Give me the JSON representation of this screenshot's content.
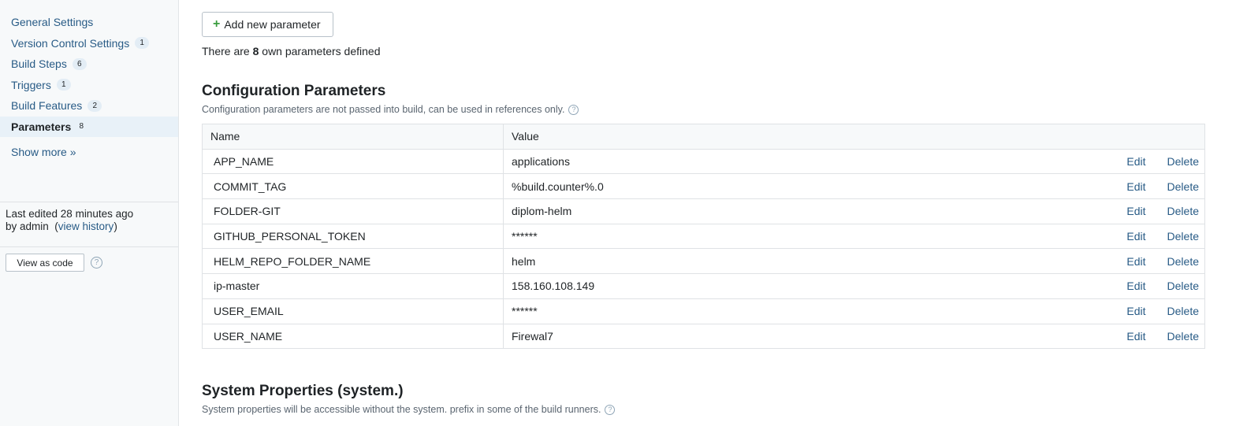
{
  "sidebar": {
    "items": [
      {
        "label": "General Settings",
        "badge": ""
      },
      {
        "label": "Version Control Settings",
        "badge": "1"
      },
      {
        "label": "Build Steps",
        "badge": "6"
      },
      {
        "label": "Triggers",
        "badge": "1"
      },
      {
        "label": "Build Features",
        "badge": "2"
      },
      {
        "label": "Parameters",
        "badge": "8",
        "active": true
      }
    ],
    "show_more": "Show more »",
    "last_edited_line1": "Last edited 28 minutes ago",
    "last_edited_by": "by admin",
    "view_history": "view history",
    "view_as_code": "View as code",
    "help_glyph": "?"
  },
  "main": {
    "add_button_label": "Add new parameter",
    "plus_glyph": "+",
    "own_params_prefix": "There are ",
    "own_params_count": "8",
    "own_params_suffix": " own parameters defined",
    "config_section": {
      "title": "Configuration Parameters",
      "description": "Configuration parameters are not passed into build, can be used in references only."
    },
    "table": {
      "headers": {
        "name": "Name",
        "value": "Value"
      },
      "rows": [
        {
          "name": "APP_NAME",
          "value": "applications"
        },
        {
          "name": "COMMIT_TAG",
          "value": "%build.counter%.0"
        },
        {
          "name": "FOLDER-GIT",
          "value": "diplom-helm"
        },
        {
          "name": "GITHUB_PERSONAL_TOKEN",
          "value": "******"
        },
        {
          "name": "HELM_REPO_FOLDER_NAME",
          "value": "helm"
        },
        {
          "name": "ip-master",
          "value": "158.160.108.149"
        },
        {
          "name": "USER_EMAIL",
          "value": "******"
        },
        {
          "name": "USER_NAME",
          "value": "Firewal7"
        }
      ],
      "edit_label": "Edit",
      "delete_label": "Delete"
    },
    "system_section": {
      "title": "System Properties (system.)",
      "description": "System properties will be accessible without the system. prefix in some of the build runners."
    }
  },
  "colors": {
    "link": "#285b86",
    "accent_plus": "#3a9d3f",
    "sidebar_bg": "#f7f9fa",
    "active_bg": "#e8f1f8"
  },
  "icons": [
    "plus-icon",
    "help-icon"
  ]
}
